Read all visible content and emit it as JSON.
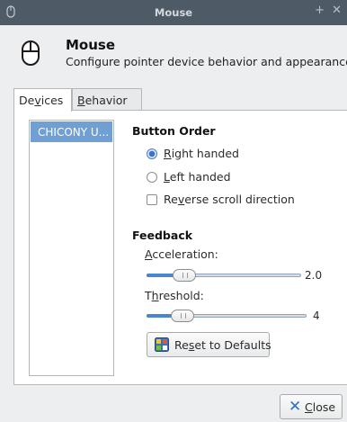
{
  "window": {
    "title": "Mouse"
  },
  "header": {
    "title": "Mouse",
    "subtitle": "Configure pointer device behavior and appearance"
  },
  "tabs": [
    {
      "pre": "De",
      "accel": "v",
      "post": "ices"
    },
    {
      "pre": "",
      "accel": "B",
      "post": "ehavior"
    }
  ],
  "devices": [
    "CHICONY U..."
  ],
  "button_order": {
    "title": "Button Order",
    "right": {
      "pre": "",
      "accel": "R",
      "post": "ight handed",
      "selected": true
    },
    "left": {
      "pre": "",
      "accel": "L",
      "post": "eft handed",
      "selected": false
    },
    "reverse": {
      "pre": "Re",
      "accel": "v",
      "post": "erse scroll direction",
      "checked": false
    }
  },
  "feedback": {
    "title": "Feedback",
    "acceleration": {
      "pre": "",
      "accel": "A",
      "post": "cceleration:",
      "value": "2.0",
      "fraction": 0.2
    },
    "threshold": {
      "pre": "T",
      "accel": "h",
      "post": "reshold:",
      "value": "4",
      "fraction": 0.18
    }
  },
  "buttons": {
    "reset": {
      "pre": "Re",
      "accel": "s",
      "post": "et to Defaults"
    },
    "close": {
      "pre": "",
      "accel": "C",
      "post": "lose"
    }
  },
  "colors": {
    "titlebar": "#4e5a66",
    "selection": "#6f9fd3",
    "accent": "#4a86d0"
  }
}
